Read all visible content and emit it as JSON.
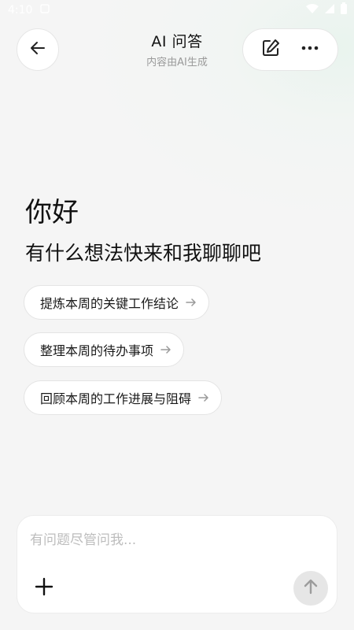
{
  "status_bar": {
    "time": "4:10"
  },
  "header": {
    "title": "AI 问答",
    "subtitle": "内容由AI生成"
  },
  "main": {
    "greeting": "你好",
    "tagline": "有什么想法快来和我聊聊吧",
    "suggestions": [
      {
        "label": "提炼本周的关键工作结论"
      },
      {
        "label": "整理本周的待办事项"
      },
      {
        "label": "回顾本周的工作进展与阻碍"
      }
    ]
  },
  "composer": {
    "placeholder": "有问题尽管问我..."
  },
  "icons": {
    "back": "arrow-left-icon",
    "edit": "edit-icon",
    "more": "more-horizontal-icon",
    "add": "plus-icon",
    "send": "arrow-up-icon"
  }
}
